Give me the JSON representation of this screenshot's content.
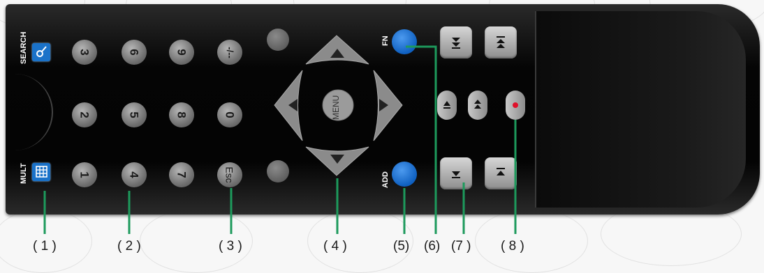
{
  "remote": {
    "search_label": "SEARCH",
    "mult_label": "MULT",
    "fn_label": "FN",
    "add_label": "ADD",
    "menu_label": "MENU",
    "number_keys": [
      {
        "label": "3"
      },
      {
        "label": "6"
      },
      {
        "label": "9"
      },
      {
        "label": "-/--"
      },
      {
        "label": "2"
      },
      {
        "label": "5"
      },
      {
        "label": "8"
      },
      {
        "label": "0"
      },
      {
        "label": "1"
      },
      {
        "label": "4"
      },
      {
        "label": "7"
      },
      {
        "label": "Esc"
      }
    ]
  },
  "callouts": [
    "( 1 )",
    "( 2 )",
    "( 3 )",
    "( 4 )",
    "(5)",
    "(6)",
    "(7 )",
    "( 8 )"
  ],
  "colors": {
    "accent_blue": "#1a72c9",
    "callout_line": "#1d9a5c",
    "record_red": "#e0102a"
  }
}
